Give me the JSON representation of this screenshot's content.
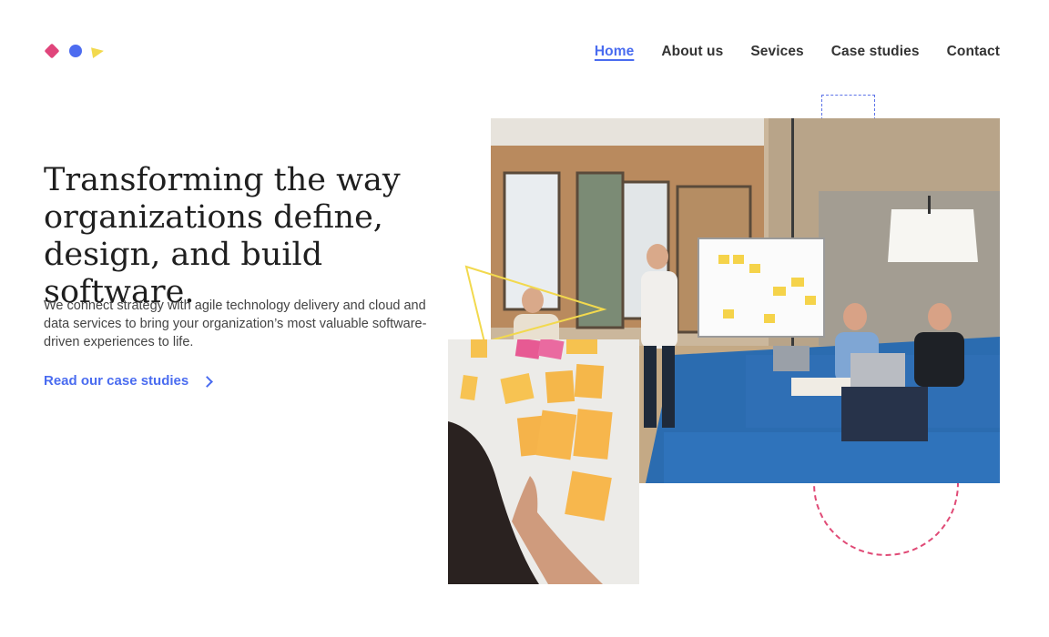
{
  "header": {
    "logo_label": "logo",
    "nav": [
      {
        "label": "Home",
        "active": true
      },
      {
        "label": "About us",
        "active": false
      },
      {
        "label": "Sevices",
        "active": false
      },
      {
        "label": "Case studies",
        "active": false
      },
      {
        "label": "Contact",
        "active": false
      }
    ]
  },
  "hero": {
    "title_line1": "Transforming the way",
    "title_line2": "organizations define,",
    "title_line3": "design, and build software.",
    "description": "We connect strategy with agile technology delivery and cloud and data services to bring your organization’s most valuable software-driven experiences to life.",
    "cta_label": "Read our case studies",
    "cta_icon": "chevron-right-icon"
  },
  "colors": {
    "accent": "#4a6cf0",
    "pink": "#e0457b",
    "yellow": "#f2d94e",
    "text": "#1f1f1f"
  }
}
